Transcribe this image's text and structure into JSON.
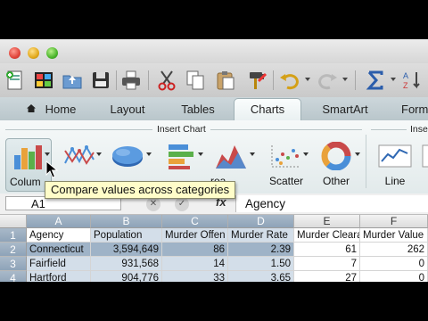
{
  "toolbar": {
    "icons": [
      "new-workbook-icon",
      "gallery-icon",
      "open-icon",
      "save-icon",
      "print-icon",
      "cut-icon",
      "copy-icon",
      "paste-icon",
      "format-painter-icon",
      "undo-icon",
      "redo-icon",
      "autosum-icon",
      "sort-icon"
    ]
  },
  "tabs": [
    {
      "label": "Home"
    },
    {
      "label": "Layout"
    },
    {
      "label": "Tables"
    },
    {
      "label": "Charts"
    },
    {
      "label": "SmartArt"
    },
    {
      "label": "Form"
    }
  ],
  "ribbon": {
    "group_insert_chart": "Insert Chart",
    "group_insert_next": "Inse",
    "buttons": [
      {
        "label": "Colum"
      },
      {
        "label": ""
      },
      {
        "label": ""
      },
      {
        "label": ""
      },
      {
        "label": "rea"
      },
      {
        "label": "Scatter"
      },
      {
        "label": "Other"
      },
      {
        "label": "Line"
      }
    ]
  },
  "tooltip": "Compare values across categories",
  "formula_bar": {
    "cell_ref": "A1",
    "cancel": "✕",
    "confirm": "✓",
    "fx": "fx",
    "content": "Agency"
  },
  "sheet": {
    "columns": [
      "A",
      "B",
      "C",
      "D",
      "E",
      "F"
    ],
    "rows": [
      {
        "n": "1",
        "cells": [
          "Agency",
          "Population",
          "Murder Offen",
          "Murder Rate",
          "Murder Cleara",
          "Murder Value"
        ]
      },
      {
        "n": "2",
        "cells": [
          "Connecticut",
          "3,594,649",
          "86",
          "2.39",
          "61",
          "262"
        ]
      },
      {
        "n": "3",
        "cells": [
          "Fairfield",
          "931,568",
          "14",
          "1.50",
          "7",
          "0"
        ]
      },
      {
        "n": "4",
        "cells": [
          "Hartford",
          "904,776",
          "33",
          "3.65",
          "27",
          "0"
        ]
      }
    ]
  },
  "colors": {
    "accent": "#8ea3b8",
    "selection": "#d3dee9",
    "tooltip_bg": "#fffdc9"
  }
}
